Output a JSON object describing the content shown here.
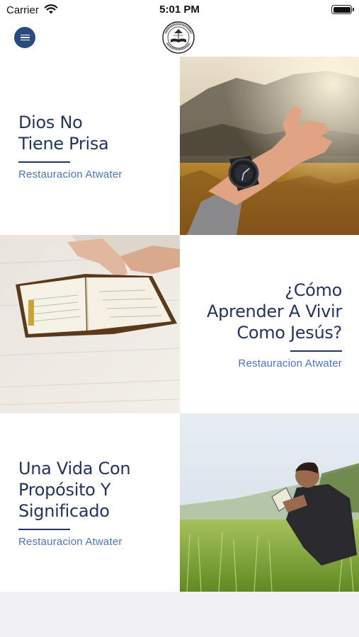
{
  "status_bar": {
    "carrier": "Carrier",
    "time": "5:01 PM"
  },
  "header": {
    "menu_icon": "hamburger-menu-icon",
    "logo_icon": "church-logo-icon"
  },
  "posts": [
    {
      "title_line1": "Dios No",
      "title_line2": "Tiene Prisa",
      "title_line3": "",
      "author": "Restauracion Atwater",
      "image": "hand-with-watch-mountains-photo"
    },
    {
      "title_line1": "¿Cómo",
      "title_line2": "Aprender A Vivir",
      "title_line3": "Como Jesús?",
      "author": "Restauracion Atwater",
      "image": "open-bible-on-table-photo"
    },
    {
      "title_line1": "Una Vida Con",
      "title_line2": "Propósito Y",
      "title_line3": "Significado",
      "author": "Restauracion Atwater",
      "image": "man-reading-in-field-photo"
    }
  ],
  "colors": {
    "accent": "#2a4a80",
    "title": "#23355e",
    "author": "#4c74c0"
  }
}
